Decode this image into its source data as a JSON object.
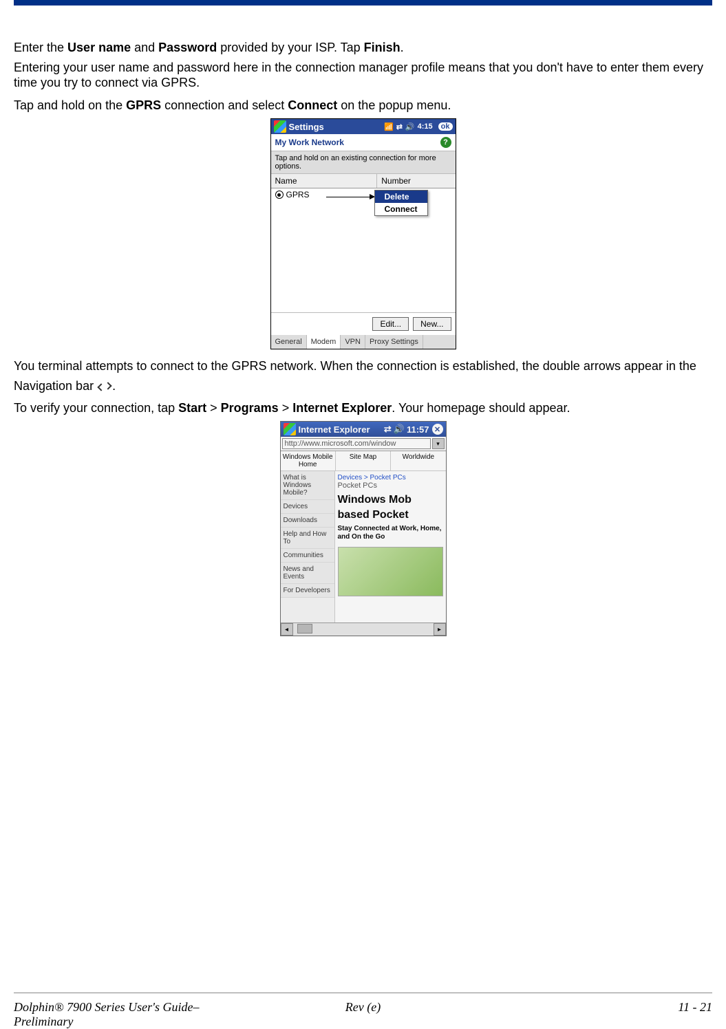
{
  "para1_a": "Enter the ",
  "para1_b": "User name",
  "para1_c": " and ",
  "para1_d": "Password",
  "para1_e": " provided by your ISP. Tap ",
  "para1_f": "Finish",
  "para1_g": ".",
  "para2": "Entering your user name and password here in the connection manager profile means that you don't have to enter them every time you try to connect via GPRS.",
  "para3_a": "Tap and hold on the ",
  "para3_b": "GPRS",
  "para3_c": " connection and select ",
  "para3_d": "Connect",
  "para3_e": " on the popup menu.",
  "para4_a": "You terminal attempts to connect to the GPRS network. When the connection is established, the double arrows appear in the Navigation bar ",
  "para4_b": ".",
  "para5_a": "To verify your connection, tap ",
  "para5_b": "Start",
  "para5_c": " > ",
  "para5_d": "Programs",
  "para5_e": " > ",
  "para5_f": "Internet Explorer",
  "para5_g": ". Your homepage should appear.",
  "shot1": {
    "title": "Settings",
    "time": "4:15",
    "ok": "ok",
    "subtitle": "My Work Network",
    "hint": "Tap and hold on an existing connection for more options.",
    "th_name": "Name",
    "th_number": "Number",
    "row_name": "GPRS",
    "popup_delete": "Delete",
    "popup_connect": "Connect",
    "btn_edit": "Edit...",
    "btn_new": "New...",
    "tabs": {
      "general": "General",
      "modem": "Modem",
      "vpn": "VPN",
      "proxy": "Proxy Settings"
    }
  },
  "shot2": {
    "title": "Internet Explorer",
    "time": "11:57",
    "url": "http://www.microsoft.com/window",
    "topnav": {
      "a": "Windows Mobile Home",
      "b": "Site Map",
      "c": "Worldwide"
    },
    "side": {
      "a": "What is Windows Mobile?",
      "b": "Devices",
      "c": "Downloads",
      "d": "Help and How To",
      "e": "Communities",
      "f": "News and Events",
      "g": "For Developers"
    },
    "crumb": "Devices > Pocket PCs",
    "sub": "Pocket PCs",
    "h1a": "Windows Mob",
    "h1b": "based Pocket",
    "tag": "Stay Connected at Work, Home, and On the Go"
  },
  "footer": {
    "left_a": "Dolphin® 7900 Series User's Guide–",
    "left_b": "Preliminary",
    "center": "Rev (e)",
    "right": "11 - 21"
  }
}
